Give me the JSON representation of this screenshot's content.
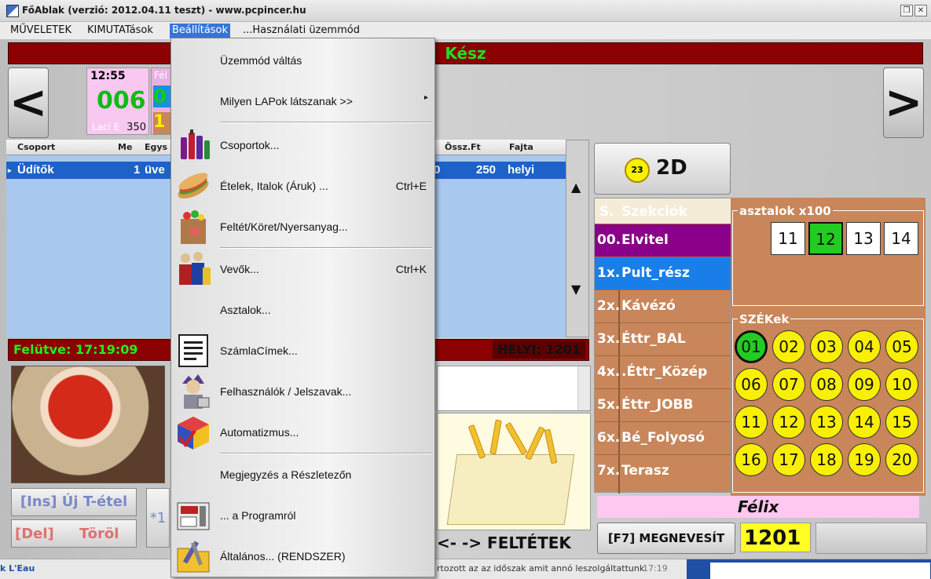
{
  "window": {
    "title": "FőAblak (verzió: 2012.04.11 teszt) - www.pcpincer.hu",
    "restore_glyph": "❐",
    "close_glyph": "✕"
  },
  "menubar": {
    "items": [
      "MŰVELETEK",
      "KIMUTATások",
      "Beállítások",
      "...Használati üzemmód"
    ]
  },
  "status": "Kész",
  "nav": {
    "prev": "<",
    "next": ">"
  },
  "order_card": {
    "time": "12:55",
    "number": "006",
    "user": "Laci E",
    "amount": "350"
  },
  "card2": {
    "line1": "Fél",
    "line2": "0",
    "line3": "1"
  },
  "grid": {
    "columns": [
      "Csoport",
      "Me",
      "Egys",
      "Össz.Ft",
      "Fajta"
    ],
    "rows": [
      {
        "csoport": "Üdítők",
        "me": "1",
        "egys": "üve",
        "ossz": "250",
        "fajta": "helyi",
        "partial": "0"
      }
    ],
    "scroll_up": "▲",
    "scroll_down": "▼"
  },
  "felutve": {
    "label": "Felütve: 17:19:09",
    "helyi": "HELYI:  1201"
  },
  "buttons": {
    "ins": "[Ins] Új T-étel",
    "del_key": "[Del]",
    "del_label": "Töröl",
    "mult": "*1",
    "feltetek": "<- -> FELTÉTEK",
    "two_d": "2D",
    "two_d_badge": "23",
    "f7": "[F7] MEGNEVESÍT",
    "f7_value": "1201"
  },
  "sections": {
    "header_num": "S.",
    "header_label": "Szekciók",
    "items": [
      {
        "num": "00.",
        "label": "Elvitel",
        "color": "#8a0088"
      },
      {
        "num": "1x.",
        "label": "Pult_rész",
        "color": "#1a7ee8"
      },
      {
        "num": "2x.",
        "label": "Kávézó",
        "color": ""
      },
      {
        "num": "3x.",
        "label": "Éttr_BAL",
        "color": ""
      },
      {
        "num": "4x.",
        "label": ".Éttr_Közép",
        "color": ""
      },
      {
        "num": "5x.",
        "label": "Éttr_JOBB",
        "color": ""
      },
      {
        "num": "6x.",
        "label": "Bé_Folyosó",
        "color": ""
      },
      {
        "num": "7x.",
        "label": "Terasz",
        "color": ""
      }
    ]
  },
  "tables": {
    "title": "asztalok x100",
    "items": [
      "11",
      "12",
      "13",
      "14"
    ],
    "active": "12"
  },
  "seats": {
    "title": "SZÉKek",
    "items": [
      "01",
      "02",
      "03",
      "04",
      "05",
      "06",
      "07",
      "08",
      "09",
      "10",
      "11",
      "12",
      "13",
      "14",
      "15",
      "16",
      "17",
      "18",
      "19",
      "20"
    ],
    "active": "01"
  },
  "waiter": "Félix",
  "menu": {
    "items": [
      {
        "label": "Üzemmód váltás",
        "shortcut": "",
        "icon": ""
      },
      {
        "label": "Milyen LAPok látszanak >>",
        "shortcut": "",
        "icon": "",
        "submenu": "▸"
      },
      {
        "label": "Csoportok...",
        "shortcut": "",
        "icon": "bottles-icon"
      },
      {
        "label": "Ételek, Italok (Áruk) ...",
        "shortcut": "Ctrl+E",
        "icon": "sandwich-icon"
      },
      {
        "label": "Feltét/Köret/Nyersanyag...",
        "shortcut": "",
        "icon": "grocery-bag-icon"
      },
      {
        "label": "Vevők...",
        "shortcut": "Ctrl+K",
        "icon": "customers-icon"
      },
      {
        "label": "Asztalok...",
        "shortcut": "",
        "icon": ""
      },
      {
        "label": "SzámlaCímek...",
        "shortcut": "",
        "icon": "invoice-icon"
      },
      {
        "label": "Felhasználók / Jelszavak...",
        "shortcut": "",
        "icon": "user-icon"
      },
      {
        "label": "Automatizmus...",
        "shortcut": "",
        "icon": "cube-icon"
      },
      {
        "label": "Megjegyzés a Részletezőn",
        "shortcut": "",
        "icon": ""
      },
      {
        "label": "... a Programról",
        "shortcut": "",
        "icon": "about-icon"
      },
      {
        "label": "Általános... (RENDSZER)",
        "shortcut": "",
        "icon": "folder-tools-icon"
      }
    ]
  },
  "taskbar": {
    "left": "k L'Eau",
    "mid": "rtozott az az időszak amit annó leszolgáltattunk",
    "time": "17:19"
  },
  "colors": {
    "status_bg": "#8b0000",
    "status_text": "#22dd22",
    "grid_bg": "#a8c8ee",
    "selection": "#1d62c8",
    "section_bg": "#c8865a",
    "seat_yellow": "#f8f000",
    "active_green": "#22cc22",
    "waiter_bg": "#ffc8f0"
  }
}
